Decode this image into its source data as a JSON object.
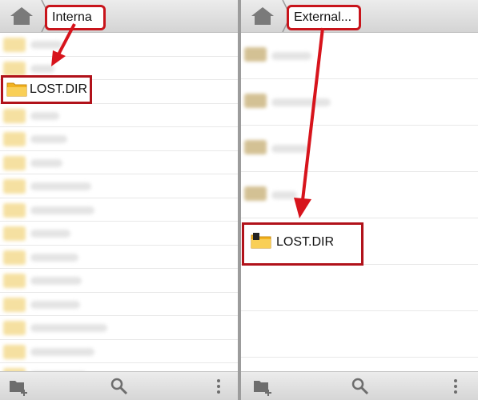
{
  "left_pane": {
    "breadcrumb": "Interna",
    "highlighted_item": "LOST.DIR"
  },
  "right_pane": {
    "breadcrumb": "External...",
    "highlighted_item": "LOST.DIR"
  },
  "icons": [
    "home-icon",
    "new-folder-icon",
    "search-icon",
    "overflow-menu-icon",
    "folder-icon",
    "sd-card-icon"
  ],
  "colors": {
    "annotation_red": "#c8141b",
    "folder_yellow": "#f7c33a"
  }
}
